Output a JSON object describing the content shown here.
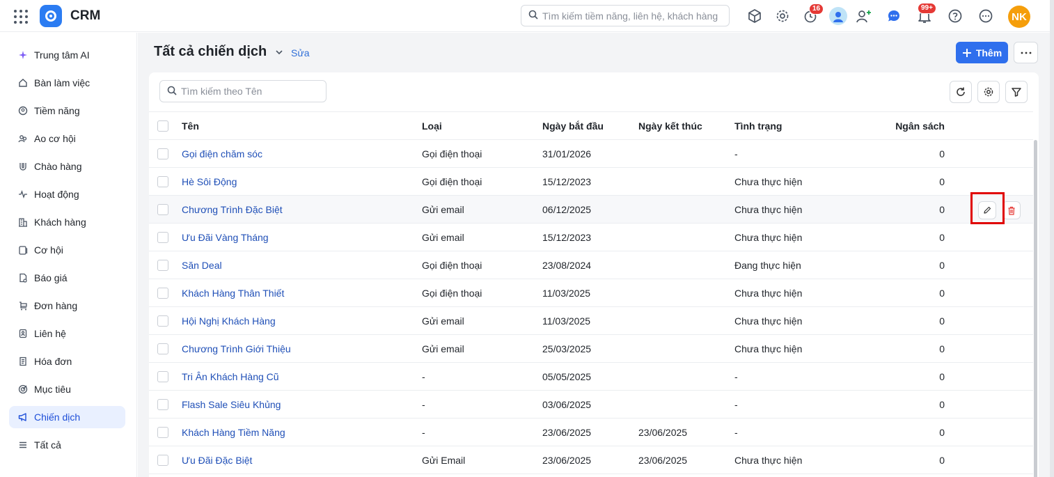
{
  "app": {
    "brand": "CRM",
    "search_placeholder": "Tìm kiếm tiềm năng, liên hệ, khách hàng",
    "timer_badge": "16",
    "notifications_badge": "99+",
    "user_initials": "NK",
    "colors": {
      "accent": "#2f6fed",
      "brand": "#2b7cf2",
      "avatar": "#f59e0b",
      "badge": "#e53935",
      "link": "#1f4fb7"
    }
  },
  "sidebar": {
    "items": [
      {
        "label": "Trung tâm AI",
        "icon": "sparkle-icon"
      },
      {
        "label": "Bàn làm việc",
        "icon": "home-icon"
      },
      {
        "label": "Tiềm năng",
        "icon": "target-user-icon"
      },
      {
        "label": "Ao cơ hội",
        "icon": "users-icon"
      },
      {
        "label": "Chào hàng",
        "icon": "magnet-icon"
      },
      {
        "label": "Hoạt động",
        "icon": "pulse-icon"
      },
      {
        "label": "Khách hàng",
        "icon": "building-icon"
      },
      {
        "label": "Cơ hội",
        "icon": "briefcase-icon"
      },
      {
        "label": "Báo giá",
        "icon": "quote-doc-icon"
      },
      {
        "label": "Đơn hàng",
        "icon": "cart-icon"
      },
      {
        "label": "Liên hệ",
        "icon": "contact-icon"
      },
      {
        "label": "Hóa đơn",
        "icon": "invoice-icon"
      },
      {
        "label": "Mục tiêu",
        "icon": "goal-icon"
      },
      {
        "label": "Chiến dịch",
        "icon": "megaphone-icon",
        "active": true
      },
      {
        "label": "Tất cả",
        "icon": "menu-icon"
      }
    ]
  },
  "page": {
    "title": "Tất cả chiến dịch",
    "edit_link": "Sửa",
    "add_label": "Thêm",
    "list_search_placeholder": "Tìm kiếm theo Tên"
  },
  "table": {
    "columns": [
      "Tên",
      "Loại",
      "Ngày bắt đầu",
      "Ngày kết thúc",
      "Tình trạng",
      "Ngân sách"
    ],
    "rows": [
      {
        "name": "Gọi điện chăm sóc",
        "type": "Gọi điện thoại",
        "start": "31/01/2026",
        "end": "",
        "status": "-",
        "budget": "0"
      },
      {
        "name": "Hè Sôi Động",
        "type": "Gọi điện thoại",
        "start": "15/12/2023",
        "end": "",
        "status": "Chưa thực hiện",
        "budget": "0"
      },
      {
        "name": "Chương Trình Đặc Biệt",
        "type": "Gửi email",
        "start": "06/12/2025",
        "end": "",
        "status": "Chưa thực hiện",
        "budget": "0"
      },
      {
        "name": "Ưu Đãi Vàng Tháng",
        "type": "Gửi email",
        "start": "15/12/2023",
        "end": "",
        "status": "Chưa thực hiện",
        "budget": "0"
      },
      {
        "name": "Săn Deal",
        "type": "Gọi điện thoại",
        "start": "23/08/2024",
        "end": "",
        "status": "Đang thực hiện",
        "budget": "0"
      },
      {
        "name": "Khách Hàng Thân Thiết",
        "type": "Gọi điện thoại",
        "start": "11/03/2025",
        "end": "",
        "status": "Chưa thực hiện",
        "budget": "0"
      },
      {
        "name": "Hội Nghị Khách Hàng",
        "type": "Gửi email",
        "start": "11/03/2025",
        "end": "",
        "status": "Chưa thực hiện",
        "budget": "0"
      },
      {
        "name": "Chương Trình Giới Thiệu",
        "type": "Gửi email",
        "start": "25/03/2025",
        "end": "",
        "status": "Chưa thực hiện",
        "budget": "0"
      },
      {
        "name": "Tri Ân Khách Hàng Cũ",
        "type": "-",
        "start": "05/05/2025",
        "end": "",
        "status": "-",
        "budget": "0"
      },
      {
        "name": "Flash Sale Siêu Khủng",
        "type": "-",
        "start": "03/06/2025",
        "end": "",
        "status": "-",
        "budget": "0"
      },
      {
        "name": "Khách Hàng Tiềm Năng",
        "type": "-",
        "start": "23/06/2025",
        "end": "23/06/2025",
        "status": "-",
        "budget": "0"
      },
      {
        "name": "Ưu Đãi Đặc Biệt",
        "type": "Gửi Email",
        "start": "23/06/2025",
        "end": "23/06/2025",
        "status": "Chưa thực hiện",
        "budget": "0"
      }
    ]
  }
}
